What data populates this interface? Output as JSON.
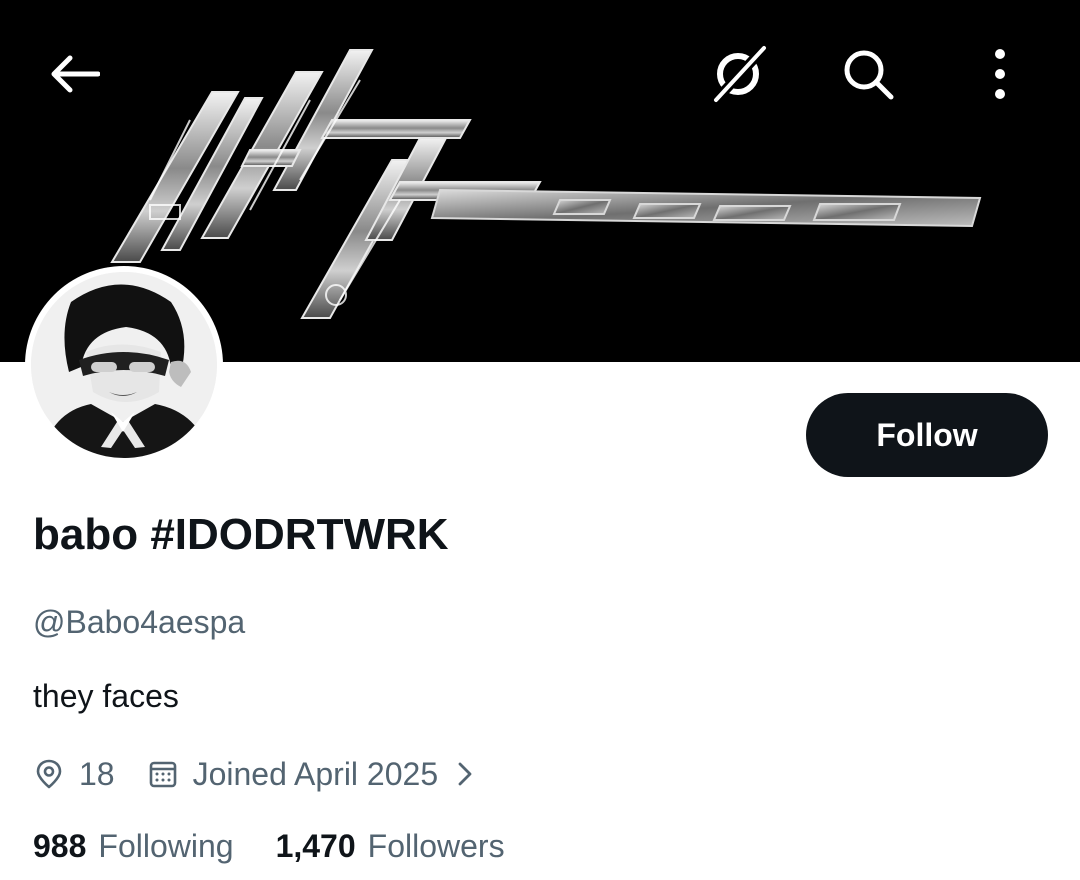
{
  "header": {
    "back_icon": "arrow-left-icon",
    "grok_icon": "grok-slash-circle-icon",
    "search_icon": "search-icon",
    "more_icon": "vertical-dots-icon",
    "banner_background": "#000000"
  },
  "profile": {
    "display_name": "babo #IDODRTWRK",
    "handle": "@Babo4aespa",
    "bio": "they faces",
    "location": "18",
    "joined": "Joined April 2025",
    "location_icon": "location-pin-icon",
    "calendar_icon": "calendar-icon"
  },
  "actions": {
    "follow_label": "Follow"
  },
  "stats": {
    "following_count": "988",
    "following_label": "Following",
    "followers_count": "1,470",
    "followers_label": "Followers"
  },
  "colors": {
    "text_primary": "#0f1419",
    "text_secondary": "#536471",
    "button_bg": "#0f1419",
    "button_text": "#ffffff"
  }
}
